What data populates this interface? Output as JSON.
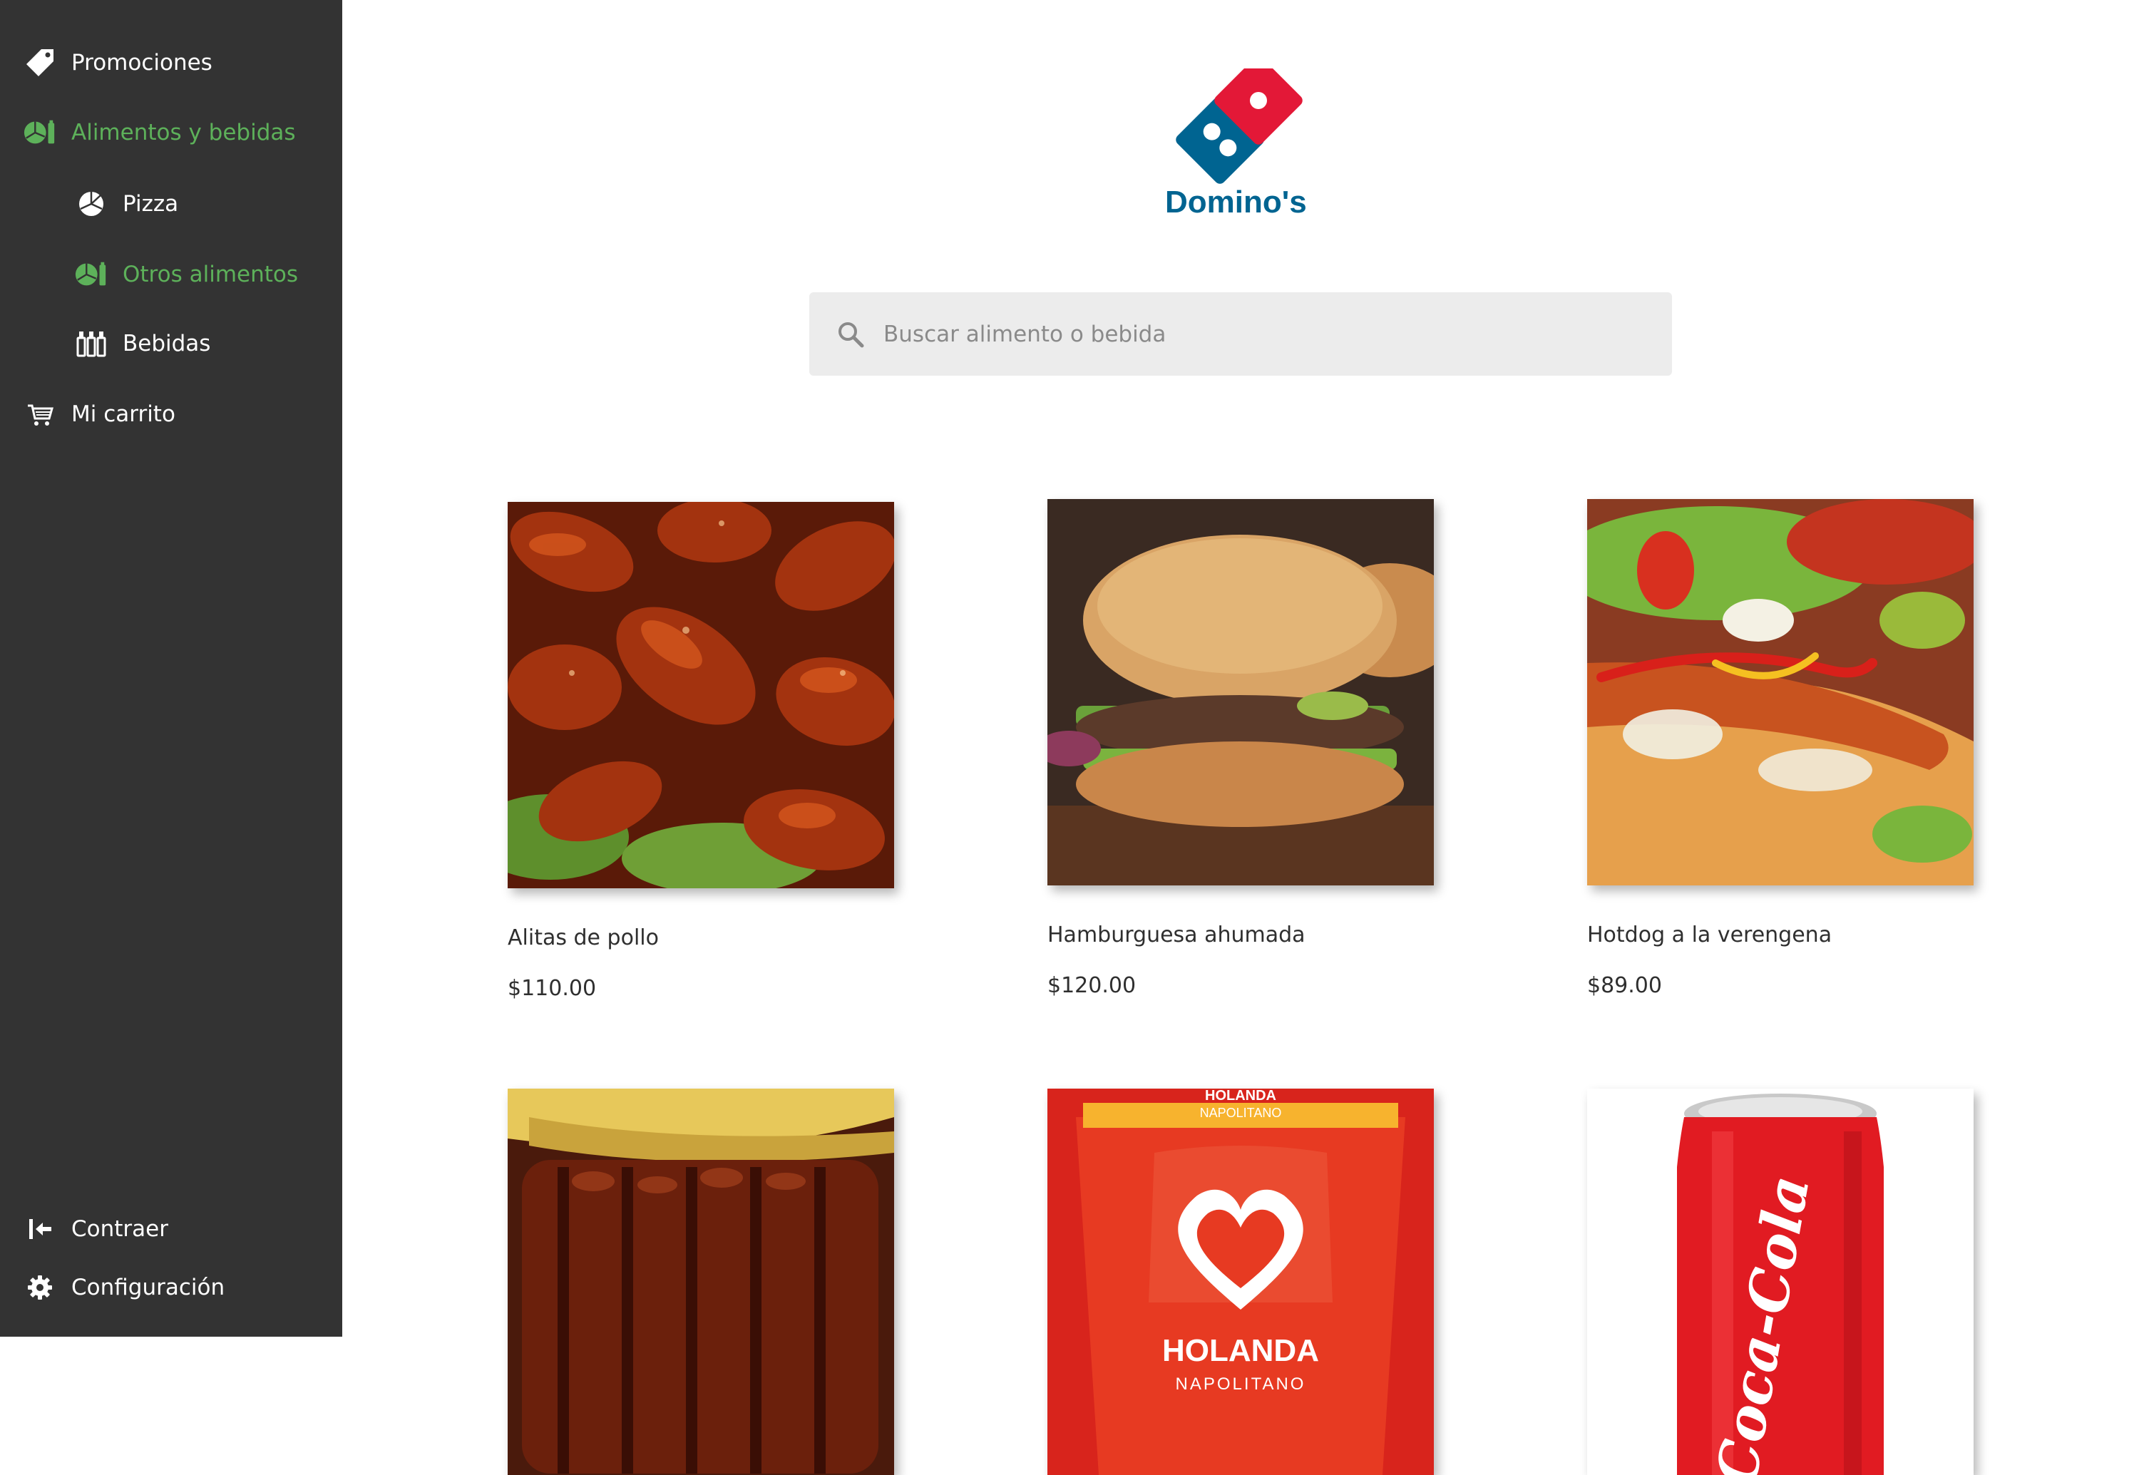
{
  "sidebar": {
    "items": [
      {
        "label": "Promociones",
        "icon": "tag-icon",
        "active": false
      },
      {
        "label": "Alimentos y bebidas",
        "icon": "food-drink-icon",
        "active": true
      },
      {
        "label": "Pizza",
        "icon": "pizza-icon",
        "active": false
      },
      {
        "label": "Otros alimentos",
        "icon": "food-drink-icon",
        "active": true
      },
      {
        "label": "Bebidas",
        "icon": "bottles-icon",
        "active": false
      },
      {
        "label": "Mi carrito",
        "icon": "cart-icon",
        "active": false
      }
    ],
    "footer": [
      {
        "label": "Contraer",
        "icon": "collapse-icon"
      },
      {
        "label": "Configuración",
        "icon": "gear-icon"
      }
    ],
    "accent_color": "#5db15a",
    "background_color": "#333333"
  },
  "brand": {
    "logo_text": "Domino's",
    "colors": {
      "red": "#e31837",
      "blue": "#006491"
    }
  },
  "search": {
    "placeholder": "Buscar alimento o bebida",
    "value": ""
  },
  "products": [
    {
      "name": "Alitas de pollo",
      "price": "$110.00"
    },
    {
      "name": "Hamburguesa ahumada",
      "price": "$120.00"
    },
    {
      "name": "Hotdog a la verengena",
      "price": "$89.00"
    },
    {
      "name": "",
      "price": ""
    },
    {
      "name": "",
      "price": ""
    },
    {
      "name": "",
      "price": ""
    }
  ],
  "product_images": {
    "ice_cream_brand": "HOLANDA",
    "ice_cream_flavor": "NAPOLITANO",
    "soda_brand": "Coca-Cola"
  }
}
